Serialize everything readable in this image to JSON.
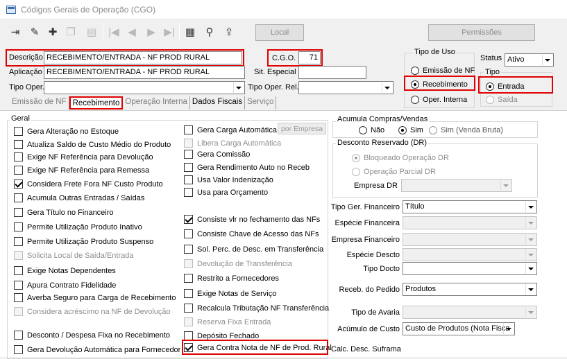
{
  "window": {
    "title": "Códigos Gerais de Operação (CGO)"
  },
  "toolbar": {
    "icons": [
      "exit-icon",
      "edit-icon",
      "add-icon",
      "copy-icon",
      "first-icon",
      "prev-icon",
      "next-icon",
      "last-icon",
      "grid-icon",
      "search-binoculars-icon",
      "save-icon"
    ],
    "local_label": "Local",
    "permissoes_label": "Permissões"
  },
  "header": {
    "descricao_label": "Descrição",
    "descricao_value": "RECEBIMENTO/ENTRADA - NF PROD RURAL",
    "cgo_label": "C.G.O.",
    "cgo_value": "71",
    "aplicacao_label": "Aplicação",
    "aplicacao_value": "RECEBIMENTO/ENTRADA - NF PROD RURAL",
    "sit_especial_label": "Sit. Especial",
    "sit_especial_value": "",
    "tipo_oper_label": "Tipo Oper.",
    "tipo_oper_value": "",
    "tipo_oper_rel_label": "Tipo Oper. Rel.",
    "tipo_oper_rel_value": ""
  },
  "tipo_uso": {
    "title": "Tipo de Uso",
    "options": [
      "Emissão de NF",
      "Recebimento",
      "Oper. Interna"
    ],
    "selected": "Recebimento"
  },
  "status": {
    "label": "Status",
    "value": "Ativo"
  },
  "tipo": {
    "title": "Tipo",
    "options": [
      "Entrada",
      "Saída"
    ],
    "selected": "Entrada"
  },
  "tabs": [
    "Emissão de NF",
    "Recebimento",
    "Operação Interna",
    "Dados Fiscais",
    "Serviço"
  ],
  "geral": {
    "title": "Geral",
    "col1": [
      {
        "label": "Gera Alteração no Estoque",
        "checked": false,
        "enabled": true
      },
      {
        "label": "Atualiza Saldo de Custo Médio do Produto",
        "checked": false,
        "enabled": true
      },
      {
        "label": "Exige NF Referência para Devolução",
        "checked": false,
        "enabled": true
      },
      {
        "label": "Exige NF Referência para Remessa",
        "checked": false,
        "enabled": true
      },
      {
        "label": "Considera Frete Fora NF Custo Produto",
        "checked": true,
        "enabled": true
      },
      {
        "label": "Acumula Outras Entradas / Saídas",
        "checked": false,
        "enabled": true
      },
      {
        "label": "Gera Título no Financeiro",
        "checked": false,
        "enabled": true
      },
      {
        "label": "Permite Utilização Produto Inativo",
        "checked": false,
        "enabled": true
      },
      {
        "label": "Permite Utilização Produto Suspenso",
        "checked": false,
        "enabled": true
      },
      {
        "label": "Solicita Local de Saída/Entrada",
        "checked": false,
        "enabled": false
      },
      {
        "label": "Exige Notas Dependentes",
        "checked": false,
        "enabled": true
      },
      {
        "label": "Apura Contrato Fidelidade",
        "checked": false,
        "enabled": true
      },
      {
        "label": "Averba Seguro para Carga de Recebimento",
        "checked": false,
        "enabled": true
      },
      {
        "label": "Considera acréscimo na NF de Devolução",
        "checked": false,
        "enabled": false
      },
      {
        "label": "Desconto / Despesa Fixa no Recebimento",
        "checked": false,
        "enabled": true
      },
      {
        "label": "Gera Devolução Automática para Fornecedor",
        "checked": false,
        "enabled": true
      }
    ],
    "col2_top": [
      {
        "label": "Gera Carga Automática",
        "checked": false,
        "enabled": true
      },
      {
        "label": "Libera Carga Automática",
        "checked": false,
        "enabled": false
      },
      {
        "label": "Gera Comissão",
        "checked": false,
        "enabled": true
      },
      {
        "label": "Gera Rendimento Auto no Receb",
        "checked": false,
        "enabled": true
      },
      {
        "label": "Usa Valor Indenização",
        "checked": false,
        "enabled": true
      },
      {
        "label": "Usa para Orçamento",
        "checked": false,
        "enabled": true
      }
    ],
    "por_empresa_label": "por Empresa",
    "col2_bottom": [
      {
        "label": "Consiste vlr no fechamento das NFs",
        "checked": true,
        "enabled": true
      },
      {
        "label": "Consiste Chave de Acesso das NFs",
        "checked": false,
        "enabled": true
      },
      {
        "label": "Sol. Perc. de Desc. em Transferência",
        "checked": false,
        "enabled": true
      },
      {
        "label": "Devolução de Transferência",
        "checked": false,
        "enabled": false
      },
      {
        "label": "Restrito a Fornecedores",
        "checked": false,
        "enabled": true
      },
      {
        "label": "Exige Notas de Serviço",
        "checked": false,
        "enabled": true
      },
      {
        "label": "Recalcula Tributação NF Transferência",
        "checked": false,
        "enabled": true
      },
      {
        "label": "Reserva Fixa Entrada",
        "checked": false,
        "enabled": false
      },
      {
        "label": "Depósito Fechado",
        "checked": false,
        "enabled": true
      },
      {
        "label": "Gera Contra Nota de NF de Prod. Rural",
        "checked": true,
        "enabled": true
      }
    ]
  },
  "acumula": {
    "title": "Acumula Compras/Vendas",
    "options": [
      "Não",
      "Sim",
      "Sim (Venda Bruta)"
    ],
    "selected": "Sim"
  },
  "desconto": {
    "title": "Desconto Reservado (DR)",
    "options": [
      "Bloqueado Operação DR",
      "Operação Parcial DR"
    ],
    "selected": "Bloqueado Operação DR",
    "empresa_dr_label": "Empresa DR",
    "empresa_dr_value": ""
  },
  "right_fields": [
    {
      "label": "Tipo Ger. Financeiro",
      "value": "Título",
      "enabled": true
    },
    {
      "label": "Espécie Financeira",
      "value": "",
      "enabled": false
    },
    {
      "label": "Empresa Financeiro",
      "value": "",
      "enabled": false
    },
    {
      "label": "Espécie Descto",
      "value": "",
      "enabled": false
    },
    {
      "label": "Tipo Docto",
      "value": "",
      "enabled": true
    },
    {
      "label": "Receb. do Pedido",
      "value": "Produtos",
      "enabled": true
    },
    {
      "label": "Tipo de Avaria",
      "value": "",
      "enabled": false
    },
    {
      "label": "Acúmulo de Custo",
      "value": "Custo de Produtos (Nota Fisca",
      "enabled": true
    }
  ],
  "calc_desc_label": "Calc. Desc. Suframa"
}
